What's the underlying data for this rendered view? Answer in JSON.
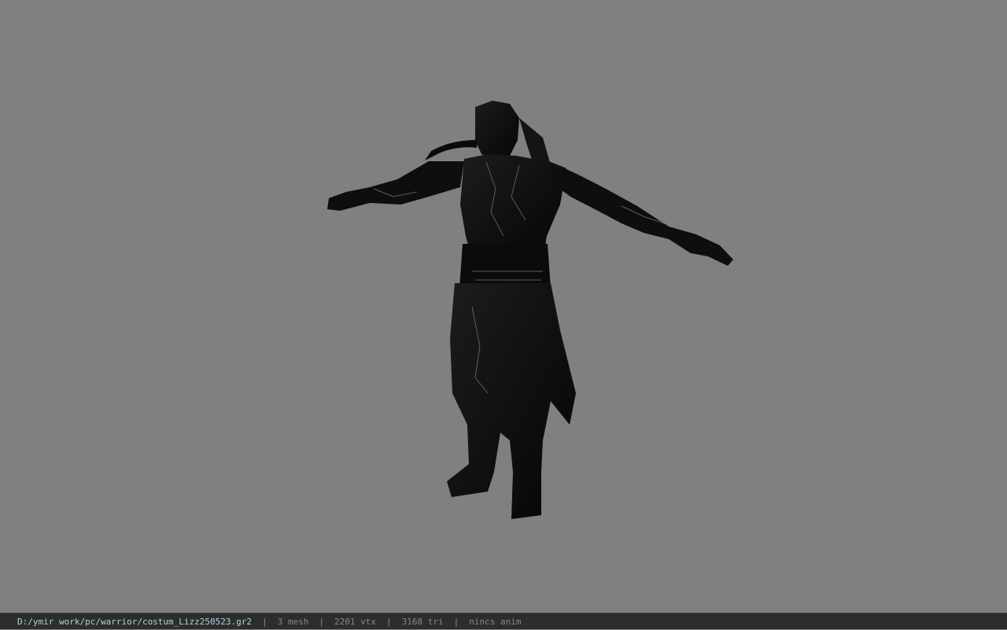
{
  "viewer": {
    "background_color": "#808080",
    "model": "warrior-character-model"
  },
  "status": {
    "file_path": "D:/ymir work/pc/warrior/costum_Lizz250523.gr2",
    "separator": "|",
    "mesh": "3 mesh",
    "vertices": "2201 vtx",
    "triangles": "3168 tri",
    "animation": "nincs anim"
  }
}
